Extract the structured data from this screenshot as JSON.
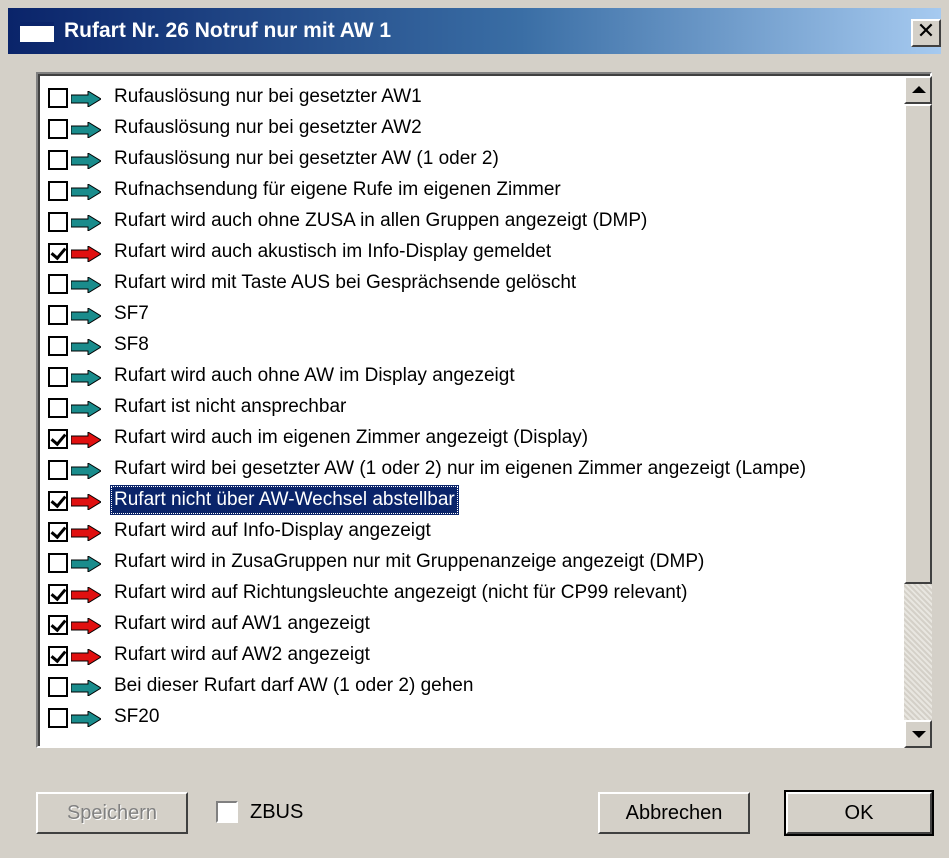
{
  "window": {
    "title": "Rufart Nr. 26   Notruf nur mit AW 1",
    "close_glyph": "✕"
  },
  "colors": {
    "arrow_unchecked": "#1a8c8c",
    "arrow_checked": "#e01010",
    "selection": "#0a246a"
  },
  "list": {
    "items": [
      {
        "label": "Rufauslösung nur bei gesetzter AW1",
        "checked": false
      },
      {
        "label": "Rufauslösung nur bei gesetzter AW2",
        "checked": false
      },
      {
        "label": "Rufauslösung nur bei gesetzter AW (1 oder 2)",
        "checked": false
      },
      {
        "label": "Rufnachsendung für eigene Rufe im eigenen Zimmer",
        "checked": false
      },
      {
        "label": "Rufart wird auch ohne ZUSA in allen Gruppen angezeigt (DMP)",
        "checked": false
      },
      {
        "label": "Rufart wird auch akustisch im Info-Display gemeldet",
        "checked": true
      },
      {
        "label": "Rufart wird mit Taste AUS bei Gesprächsende gelöscht",
        "checked": false
      },
      {
        "label": "SF7",
        "checked": false
      },
      {
        "label": "SF8",
        "checked": false
      },
      {
        "label": "Rufart wird auch ohne AW im Display angezeigt",
        "checked": false
      },
      {
        "label": "Rufart ist nicht ansprechbar",
        "checked": false
      },
      {
        "label": "Rufart wird auch im eigenen Zimmer angezeigt (Display)",
        "checked": true
      },
      {
        "label": "Rufart wird bei gesetzter AW (1 oder 2) nur im eigenen Zimmer angezeigt (Lampe)",
        "checked": false
      },
      {
        "label": "Rufart nicht über AW-Wechsel abstellbar",
        "checked": true,
        "selected": true
      },
      {
        "label": "Rufart wird auf Info-Display angezeigt",
        "checked": true
      },
      {
        "label": "Rufart wird in ZusaGruppen nur mit Gruppenanzeige angezeigt (DMP)",
        "checked": false
      },
      {
        "label": "Rufart wird auf Richtungsleuchte angezeigt (nicht für CP99 relevant)",
        "checked": true
      },
      {
        "label": "Rufart wird auf AW1 angezeigt",
        "checked": true
      },
      {
        "label": "Rufart wird auf AW2 angezeigt",
        "checked": true
      },
      {
        "label": "Bei dieser Rufart darf AW (1 oder 2) gehen",
        "checked": false
      },
      {
        "label": "SF20",
        "checked": false
      }
    ]
  },
  "footer": {
    "save_label": "Speichern",
    "zbus_label": "ZBUS",
    "zbus_checked": false,
    "cancel_label": "Abbrechen",
    "ok_label": "OK"
  }
}
